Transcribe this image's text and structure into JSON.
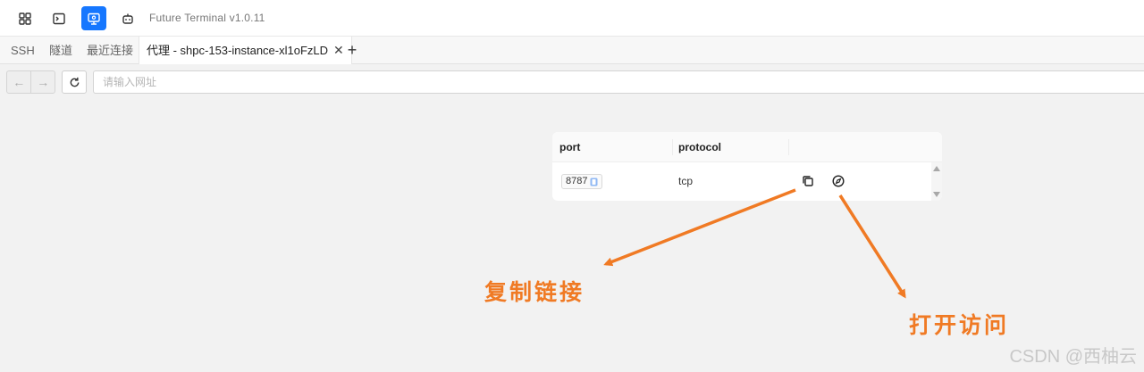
{
  "titlebar": {
    "app_title": "Future Terminal v1.0.11",
    "buttons": [
      {
        "icon": "grid-icon"
      },
      {
        "icon": "terminal-icon"
      },
      {
        "icon": "monitor-icon",
        "active": true
      },
      {
        "icon": "robot-icon"
      }
    ]
  },
  "tabs": {
    "items": [
      {
        "label": "SSH"
      },
      {
        "label": "隧道"
      },
      {
        "label": "最近连接"
      }
    ],
    "active_tab": {
      "label": "代理 - shpc-153-instance-xl1oFzLD",
      "close_symbol": "✕"
    },
    "add_symbol": "+"
  },
  "toolbar": {
    "back_symbol": "←",
    "forward_symbol": "→",
    "url_placeholder": "请输入网址",
    "url_value": ""
  },
  "table": {
    "columns": [
      "port",
      "protocol",
      ""
    ],
    "rows": [
      {
        "port": "8787",
        "protocol": "tcp"
      }
    ],
    "actions": [
      "copy-link-icon",
      "open-compass-icon"
    ]
  },
  "annotations": {
    "copy_label": "复制链接",
    "open_label": "打开访问",
    "color": "#f07a24"
  },
  "watermark": "CSDN @西柚云",
  "colors": {
    "accent": "#1677ff",
    "background": "#f2f2f2"
  }
}
